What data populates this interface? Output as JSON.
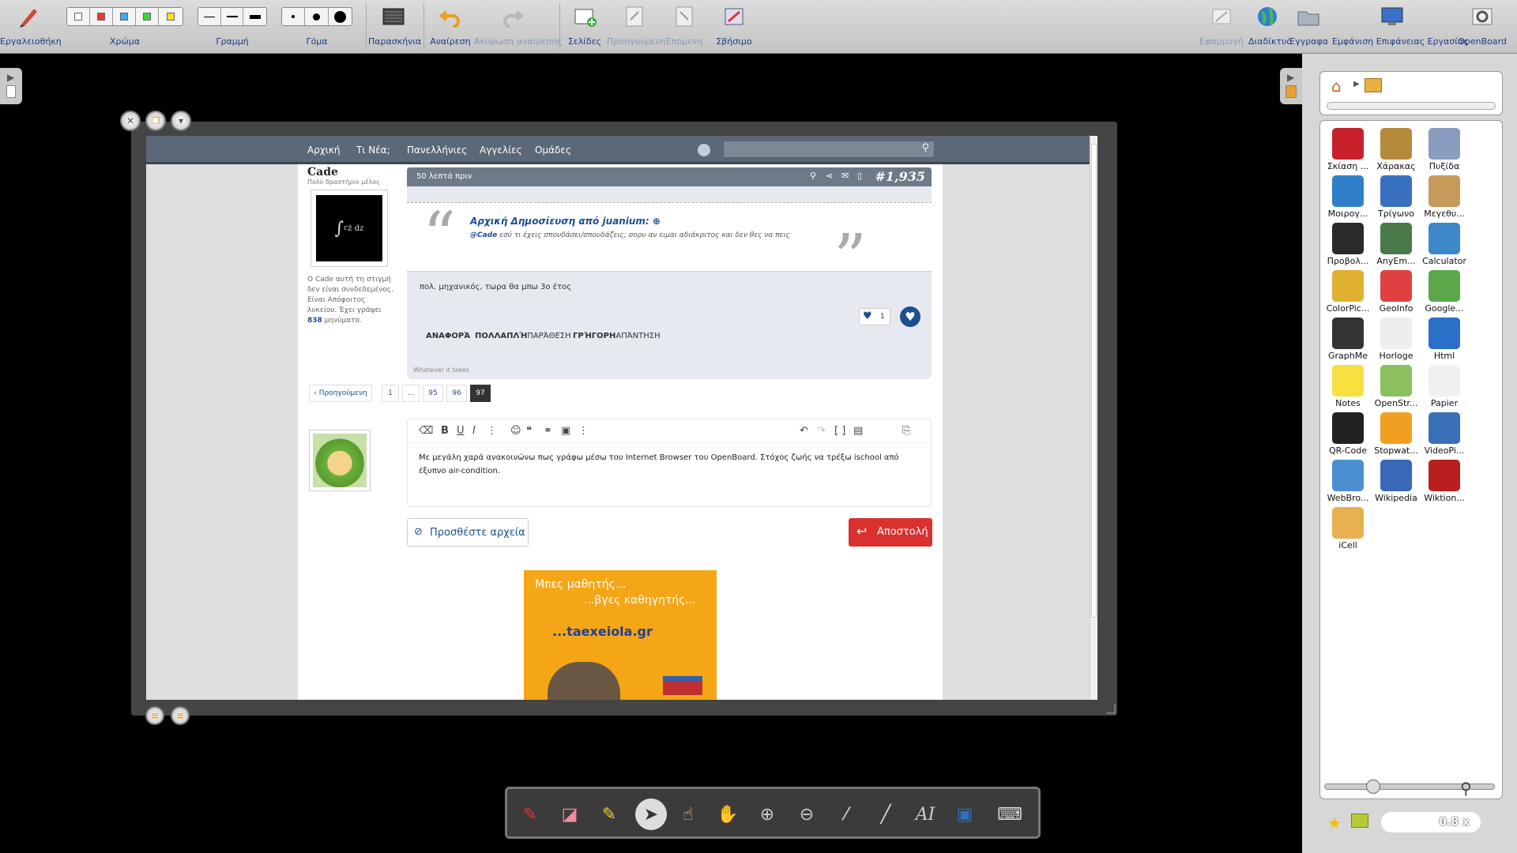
{
  "toolbar": {
    "toolbox": "Εργαλειοθήκη",
    "color": "Χρώμα",
    "line": "Γραμμή",
    "eraser": "Γόμα",
    "backgrounds": "Παρασκήνια",
    "undo": "Αναίρεση",
    "redo": "Ακύρωση αναίρεσης",
    "pages": "Σελίδες",
    "previous": "Προηγούμενη",
    "next": "Επόμενη",
    "clear": "Σβήσιμο",
    "apply": "Εφαρμογή",
    "web": "Διαδίκτυο",
    "documents": "Έγγραφα",
    "desktop": "Εμφάνιση Επιφάνειας Εργασίας",
    "openboard": "OpenBoard"
  },
  "colors": [
    "#ffffff",
    "#e8392b",
    "#3fa9f5",
    "#3fd440",
    "#f7e01c"
  ],
  "site": {
    "nav": [
      "Αρχική",
      "Τι Νέα;",
      "Πανελλήνιες",
      "Αγγελίες",
      "Ομάδες"
    ],
    "user_name": "Cade",
    "user_title": "Πολύ δραστήριο μέλος",
    "status_line1": "Ο Cade αυτή τη στιγμή",
    "status_line2": "δεν είναι συνδεδεμένος.",
    "status_line3": "Είναι Απόφοιτος",
    "status_line4": "λυκείου. Έχει γράψει",
    "status_count": "838",
    "status_tail": "μηνύματα.",
    "post_time": "50 λεπτά πριν",
    "post_number": "#1,935",
    "quote_title": "Αρχική Δημοσίευση από juanium:",
    "quote_user": "@Cade",
    "quote_text": "εσύ τι έχεις σπουδάσει/σπουδάζεις; σορυ αν ειμαι αδιάκριτος και δεν θες να πεις",
    "post_text": "πολ. μηχανικός, τωρα θα μπω 3ο έτος",
    "like_count": "1",
    "action_report": "Αναφορά",
    "action_multi": "Πολλαπλή",
    "action_quote": "Παράθεση",
    "action_fast": "Γρήγορη",
    "action_reply": "Απάντηση",
    "signature": "Whatever it takes",
    "pager_prev": "‹ Προηγούμενη",
    "pages": [
      "1",
      "…",
      "95",
      "96",
      "97"
    ],
    "editor_text": "Με μεγάλη χαρά ανακοινώνω πως γράφω μέσω του Internet Browser του OpenBoard. Στόχος ζωής να τρέξω ischool από έξυπνο air-condition.",
    "attach_label": "Προσθέστε αρχεία",
    "send_label": "Αποστολή",
    "ad_line1": "Μπες μαθητής...",
    "ad_line2": "...βγες καθηγητής...",
    "ad_site": "...taexeiola.gr"
  },
  "library": [
    {
      "label": "Σκίαση ...",
      "color": "#c8202a"
    },
    {
      "label": "Χάρακας",
      "color": "#b58a3b"
    },
    {
      "label": "Πυξίδα",
      "color": "#8a9cc0"
    },
    {
      "label": "Μοιρογ...",
      "color": "#2f7fc8"
    },
    {
      "label": "Τρίγωνο",
      "color": "#3a6fc0"
    },
    {
      "label": "Μεγεθυ...",
      "color": "#c79a5a"
    },
    {
      "label": "Προβολ...",
      "color": "#2a2a2a"
    },
    {
      "label": "AnyEm...",
      "color": "#4a7a4a"
    },
    {
      "label": "Calculator",
      "color": "#3c88c8"
    },
    {
      "label": "ColorPic...",
      "color": "#e0b030"
    },
    {
      "label": "GeoInfo",
      "color": "#e04040"
    },
    {
      "label": "Google...",
      "color": "#5aa84a"
    },
    {
      "label": "GraphMe",
      "color": "#333333"
    },
    {
      "label": "Horloge",
      "color": "#eeeeee"
    },
    {
      "label": "Html",
      "color": "#2a6fc8"
    },
    {
      "label": "Notes",
      "color": "#f7e040"
    },
    {
      "label": "OpenStr...",
      "color": "#8ac060"
    },
    {
      "label": "Papier",
      "color": "#f0f0f0"
    },
    {
      "label": "QR-Code",
      "color": "#222222"
    },
    {
      "label": "Stopwat...",
      "color": "#f0a020"
    },
    {
      "label": "VideoPi...",
      "color": "#3a70b8"
    },
    {
      "label": "WebBro...",
      "color": "#4a90d0"
    },
    {
      "label": "Wikipedia",
      "color": "#3a68b8"
    },
    {
      "label": "Wiktion...",
      "color": "#b82020"
    },
    {
      "label": "iCell",
      "color": "#e8b050"
    }
  ],
  "zoom_value": "0.8 x"
}
